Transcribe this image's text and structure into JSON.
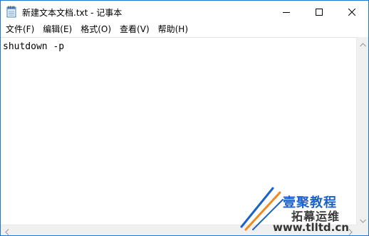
{
  "window": {
    "title": "新建文本文档.txt - 记事本",
    "accent_color": "#1f75cf"
  },
  "caption_buttons": {
    "minimize_icon": "minimize-icon",
    "maximize_icon": "maximize-icon",
    "close_icon": "close-icon"
  },
  "menu": {
    "items": [
      {
        "label": "文件(F)"
      },
      {
        "label": "编辑(E)"
      },
      {
        "label": "格式(O)"
      },
      {
        "label": "查看(V)"
      },
      {
        "label": "帮助(H)"
      }
    ]
  },
  "editor": {
    "content": "shutdown -p"
  },
  "watermark": {
    "line1": "壹聚教程",
    "line2": "拓幕运维",
    "line3": "www.tlltd.cn",
    "colors": {
      "blue": "#1a62c9",
      "orange": "#f08a1c"
    }
  }
}
